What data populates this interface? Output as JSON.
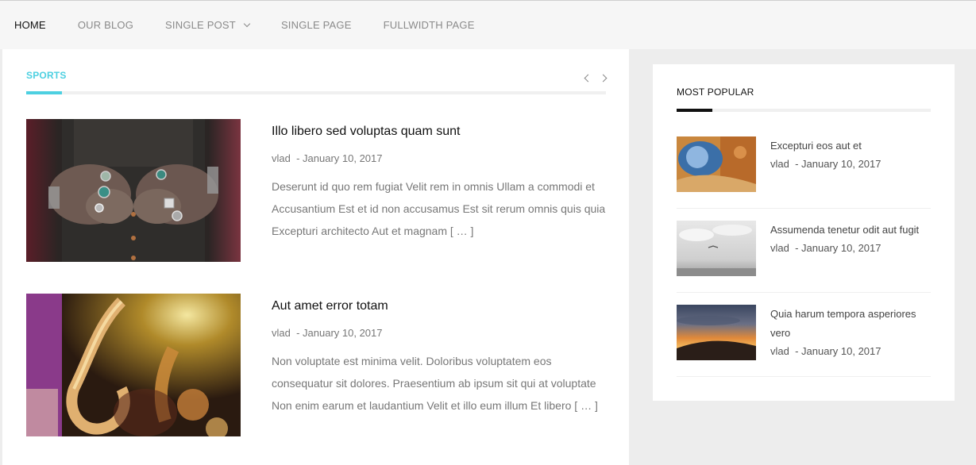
{
  "nav": {
    "items": [
      {
        "label": "HOME",
        "active": true
      },
      {
        "label": "OUR BLOG"
      },
      {
        "label": "SINGLE POST",
        "has_dropdown": true
      },
      {
        "label": "SINGLE PAGE"
      },
      {
        "label": "FULLWIDTH PAGE"
      }
    ]
  },
  "section": {
    "title": "SPORTS",
    "accent_color": "#4dd0e1"
  },
  "posts": [
    {
      "title": "Illo libero sed voluptas quam sunt",
      "author": "vlad",
      "date": "- January 10, 2017",
      "excerpt": "Deserunt id quo rem fugiat Velit rem in omnis Ullam a commodi et Accusantium Est et id non accusamus Est sit rerum omnis quis quia Excepturi architecto Aut et magnam [ … ]",
      "image": "tattooed-hands-rings"
    },
    {
      "title": "Aut amet error totam",
      "author": "vlad",
      "date": "- January 10, 2017",
      "excerpt": "Non voluptate est minima velit. Doloribus voluptatem eos consequatur sit dolores. Praesentium ab ipsum sit qui at voluptate Non enim earum et laudantium Velit et illo eum illum Et libero [ … ]",
      "image": "saxophone-players"
    }
  ],
  "sidebar": {
    "title": "MOST POPULAR",
    "items": [
      {
        "title": "Excepturi eos aut et",
        "author": "vlad",
        "date": "- January 10, 2017",
        "image": "orange-blue-texture"
      },
      {
        "title": "Assumenda tenetur odit aut fugit",
        "author": "vlad",
        "date": "- January 10, 2017",
        "image": "cloudy-sky-bird"
      },
      {
        "title": "Quia harum tempora asperiores vero",
        "author": "vlad",
        "date": "- January 10, 2017",
        "image": "sunset-hill"
      }
    ]
  }
}
